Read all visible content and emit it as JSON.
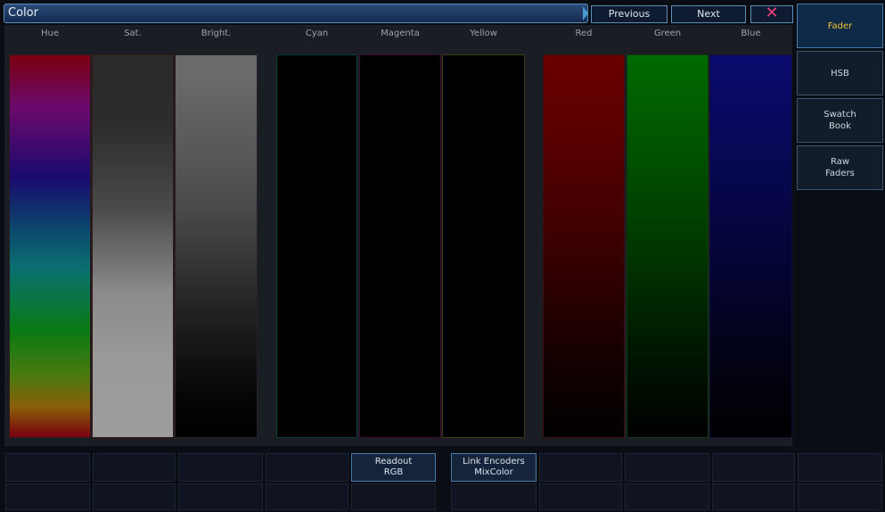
{
  "window": {
    "title": "Color"
  },
  "nav": {
    "previous_label": "Previous",
    "next_label": "Next",
    "close_glyph": "✕"
  },
  "faders": {
    "labels": [
      "Hue",
      "Sat.",
      "Bright.",
      "Cyan",
      "Magenta",
      "Yellow",
      "Red",
      "Green",
      "Blue"
    ]
  },
  "side_tabs": [
    {
      "label": "Fader",
      "active": true
    },
    {
      "label": "HSB"
    },
    {
      "label": "Swatch\nBook"
    },
    {
      "label": "Raw\nFaders"
    }
  ],
  "softkeys": {
    "readout": "Readout\nRGB",
    "link_encoders": "Link Encoders\nMixColor"
  },
  "colors": {
    "accent": "#5a8fb8",
    "active_tab_text": "#f0c030",
    "close": "#e8407a",
    "background": "#0b0d14"
  }
}
